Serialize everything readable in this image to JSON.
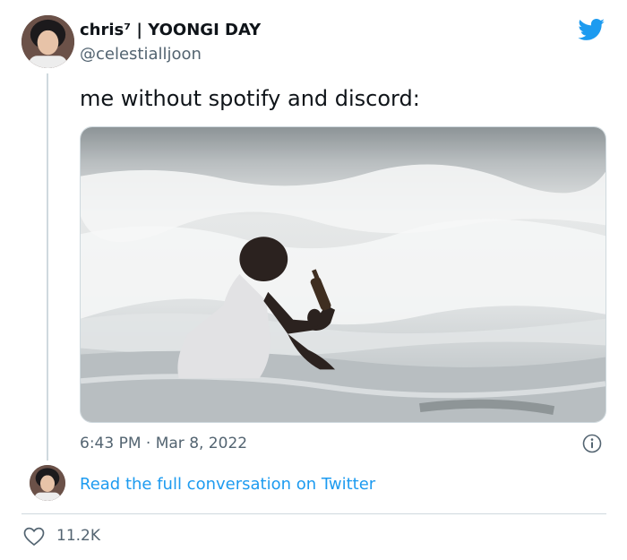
{
  "tweet": {
    "display_name": "chris⁷ | YOONGI DAY",
    "handle": "@celestialljoon",
    "text": "me without spotify and discord:",
    "timestamp": "6:43 PM · Mar 8, 2022",
    "read_conversation_label": "Read the full conversation on Twitter",
    "like_count": "11.2K"
  },
  "icons": {
    "brand": "twitter-bird-icon",
    "info": "info-icon",
    "like": "heart-icon"
  },
  "colors": {
    "accent": "#1d9bf0",
    "text": "#0f1419",
    "secondary": "#536471",
    "border": "#cfd9de"
  }
}
